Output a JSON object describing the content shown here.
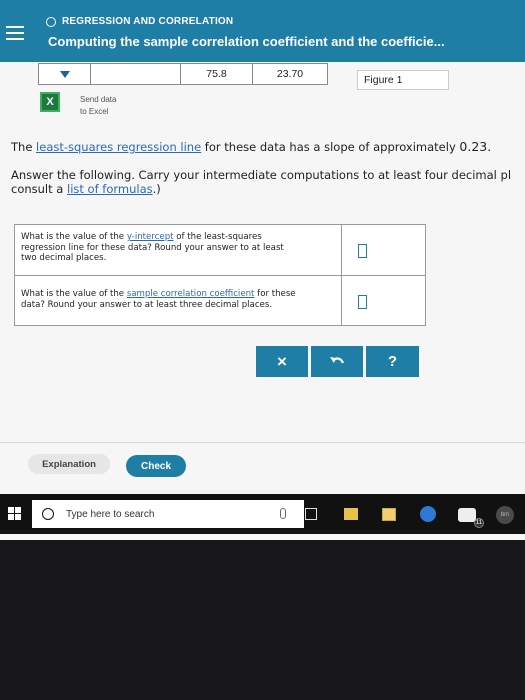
{
  "header": {
    "section": "REGRESSION AND CORRELATION",
    "title": "Computing the sample correlation coefficient and the coefficie..."
  },
  "data_table": {
    "values": [
      "75.8",
      "23.70"
    ]
  },
  "figure_button": "Figure 1",
  "excel": {
    "line1": "Send data",
    "line2": "to Excel"
  },
  "intro": {
    "prefix": "The ",
    "link": "least-squares regression line",
    "suffix": " for these data has a slope of approximately ",
    "slope": "0.23."
  },
  "instructions": {
    "line1": "Answer the following. Carry your intermediate computations to at least four decimal pl",
    "line2_prefix": "consult a ",
    "line2_link": "list of formulas",
    "line2_suffix": ".)"
  },
  "questions": [
    {
      "part1": "What is the value of the ",
      "link": "y-intercept",
      "part2": " of the least-squares",
      "line2": "regression line for these data? Round your answer to at least",
      "line3": "two decimal places."
    },
    {
      "part1": "What is the value of the ",
      "link": "sample correlation coefficient",
      "part2": " for these",
      "line2": "data? Round your answer to at least three decimal places."
    }
  ],
  "actions": {
    "clear": "×",
    "help": "?"
  },
  "bottom": {
    "explanation": "Explanation",
    "check": "Check"
  },
  "taskbar": {
    "search_placeholder": "Type here to search",
    "badge": "11",
    "tray": "bm"
  },
  "colors": {
    "accent": "#1f7ea6",
    "link": "#2a6ab8"
  }
}
